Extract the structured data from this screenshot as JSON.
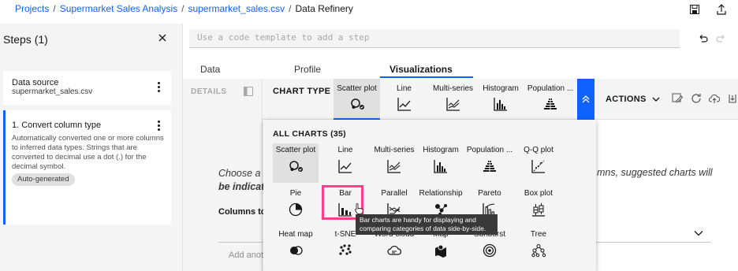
{
  "breadcrumb": {
    "items": [
      "Projects",
      "Supermarket Sales Analysis",
      "supermarket_sales.csv"
    ],
    "current": "Data Refinery"
  },
  "steps": {
    "title": "Steps (1)",
    "source": {
      "title": "Data source",
      "file": "supermarket_sales.csv"
    },
    "step1": {
      "title": "1. Convert column type",
      "description": "Automatically converted one or more columns to inferred data types. Strings that are converted to decimal use a dot (.) for the decimal symbol.",
      "tag": "Auto-generated"
    }
  },
  "code_input": {
    "placeholder": "Use a code template to add a step"
  },
  "tabs": [
    "Data",
    "Profile",
    "Visualizations"
  ],
  "details_label": "DETAILS",
  "chart_type_label": "CHART TYPE",
  "chart_types": [
    {
      "label": "Scatter plot",
      "icon": "scatter-plot-icon"
    },
    {
      "label": "Line",
      "icon": "line-chart-icon"
    },
    {
      "label": "Multi-series",
      "icon": "multi-series-icon"
    },
    {
      "label": "Histogram",
      "icon": "histogram-icon"
    },
    {
      "label": "Population ...",
      "icon": "population-pyramid-icon"
    }
  ],
  "actions_label": "ACTIONS",
  "main": {
    "hint_line1": "Choose a c",
    "hint_line2": "be indicate",
    "hint_right": "mns, suggested charts will",
    "columns_label": "Columns to",
    "add_annotation": "Add anot"
  },
  "all_charts": {
    "title": "ALL CHARTS (35)",
    "rows": [
      [
        "Scatter plot",
        "Line",
        "Multi-series",
        "Histogram",
        "Population ...",
        "Q-Q plot"
      ],
      [
        "Pie",
        "Bar",
        "Parallel",
        "Relationship",
        "Pareto",
        "Box plot"
      ],
      [
        "Heat map",
        "t-SNE",
        "Word cloud",
        "Map",
        "Sunburst",
        "Tree"
      ]
    ]
  },
  "tooltip": "Bar charts are handy for displaying and comparing categories of data side-by-side.",
  "colors": {
    "accent": "#0f62fe",
    "highlight": "#ff3d8d"
  }
}
